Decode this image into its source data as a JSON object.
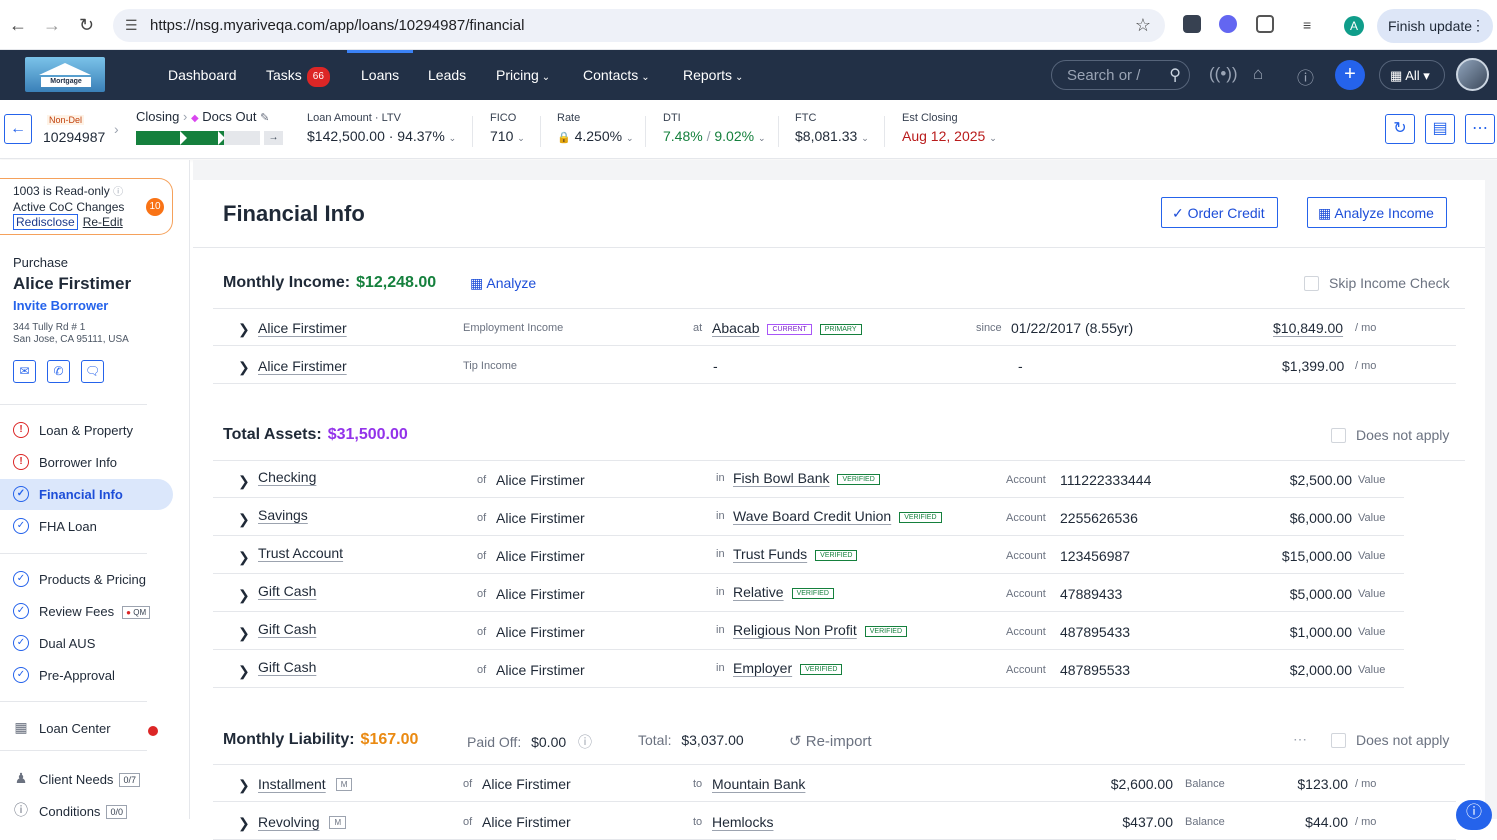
{
  "browser": {
    "url": "https://nsg.myariveqa.com/app/loans/10294987/financial",
    "profile_initial": "A",
    "finish_update": "Finish update"
  },
  "nav": {
    "items": [
      "Dashboard",
      "Tasks",
      "Loans",
      "Leads",
      "Pricing",
      "Contacts",
      "Reports"
    ],
    "tasks_count": "66",
    "search_placeholder": "Search or /",
    "scope": "All",
    "logo_text": "Mortgage"
  },
  "loan": {
    "channel": "Non-Del",
    "number": "10294987",
    "stage": "Closing",
    "milestone": "Docs Out",
    "progress_fraction": 0.71,
    "loan_amount_label": "Loan Amount · LTV",
    "loan_amount_value": "$142,500.00 · 94.37%",
    "fico_label": "FICO",
    "fico_value": "710",
    "rate_label": "Rate",
    "rate_value": "4.250%",
    "dti_label": "DTI",
    "dti_front": "7.48%",
    "dti_sep": "/",
    "dti_back": "9.02%",
    "ftc_label": "FTC",
    "ftc_value": "$8,081.33",
    "est_closing_label": "Est Closing",
    "est_closing_value": "Aug 12, 2025"
  },
  "sidebar": {
    "readonly_text": "1003 is Read-only",
    "coc_text": "Active CoC Changes",
    "coc_count": "10",
    "redisclose": "Redisclose",
    "reedit": "Re-Edit",
    "purpose": "Purchase",
    "borrower_name": "Alice Firstimer",
    "invite": "Invite Borrower",
    "address_line1": "344 Tully Rd # 1",
    "address_line2": "San Jose, CA 95111, USA",
    "items": [
      {
        "label": "Loan & Property"
      },
      {
        "label": "Borrower Info"
      },
      {
        "label": "Financial Info"
      },
      {
        "label": "FHA Loan"
      },
      {
        "label": "Products & Pricing"
      },
      {
        "label": "Review Fees",
        "tag": "QM"
      },
      {
        "label": "Dual AUS"
      },
      {
        "label": "Pre-Approval"
      },
      {
        "label": "Loan Center"
      },
      {
        "label": "Client Needs",
        "count": "0/7"
      },
      {
        "label": "Conditions",
        "count": "0/0"
      }
    ]
  },
  "main": {
    "title": "Financial Info",
    "order_credit": "Order Credit",
    "analyze_income": "Analyze Income",
    "income": {
      "label": "Monthly Income:",
      "amount": "$12,248.00",
      "analyze": "Analyze",
      "skip": "Skip Income Check",
      "rows": [
        {
          "name": "Alice Firstimer",
          "type": "Employment Income",
          "at": "at",
          "employer": "Abacab",
          "tag1": "CURRENT",
          "tag2": "PRIMARY",
          "since_label": "since",
          "since": "01/22/2017 (8.55yr)",
          "amount": "$10,849.00",
          "unit": "/ mo"
        },
        {
          "name": "Alice Firstimer",
          "type": "Tip Income",
          "dash1": "-",
          "dash2": "-",
          "amount": "$1,399.00",
          "unit": "/ mo"
        }
      ]
    },
    "assets": {
      "label": "Total Assets:",
      "amount": "$31,500.00",
      "na": "Does not apply",
      "of_label": "of",
      "in_label": "in",
      "account_label": "Account",
      "value_label": "Value",
      "verified": "VERIFIED",
      "rows": [
        {
          "type": "Checking",
          "owner": "Alice Firstimer",
          "institution": "Fish Bowl Bank",
          "account": "111222333444",
          "value": "$2,500.00"
        },
        {
          "type": "Savings",
          "owner": "Alice Firstimer",
          "institution": "Wave Board Credit Union",
          "account": "2255626536",
          "value": "$6,000.00"
        },
        {
          "type": "Trust Account",
          "owner": "Alice Firstimer",
          "institution": "Trust Funds",
          "account": "123456987",
          "value": "$15,000.00"
        },
        {
          "type": "Gift Cash",
          "owner": "Alice Firstimer",
          "institution": "Relative",
          "account": "47889433",
          "value": "$5,000.00"
        },
        {
          "type": "Gift Cash",
          "owner": "Alice Firstimer",
          "institution": "Religious Non Profit",
          "account": "487895433",
          "value": "$1,000.00"
        },
        {
          "type": "Gift Cash",
          "owner": "Alice Firstimer",
          "institution": "Employer",
          "account": "487895533",
          "value": "$2,000.00"
        }
      ]
    },
    "liability": {
      "label": "Monthly Liability:",
      "amount": "$167.00",
      "paid_off_label": "Paid Off:",
      "paid_off": "$0.00",
      "total_label": "Total:",
      "total": "$3,037.00",
      "reimport": "Re-import",
      "na": "Does not apply",
      "rows": [
        {
          "type": "Installment",
          "slot": "M",
          "of": "of",
          "owner": "Alice Firstimer",
          "to": "to",
          "creditor": "Mountain Bank",
          "balance": "$2,600.00",
          "balance_label": "Balance",
          "payment": "$123.00",
          "unit": "/ mo"
        },
        {
          "type": "Revolving",
          "slot": "M",
          "of": "of",
          "owner": "Alice Firstimer",
          "to": "to",
          "creditor": "Hemlocks",
          "balance": "$437.00",
          "balance_label": "Balance",
          "payment": "$44.00",
          "unit": "/ mo"
        }
      ]
    }
  },
  "colors": {
    "nav_bg": "#223046",
    "accent": "#2563eb",
    "income_green": "#15803d",
    "assets_purple": "#9333ea",
    "liability_orange": "#ea8a12",
    "est_closing_red": "#b91c1c"
  }
}
